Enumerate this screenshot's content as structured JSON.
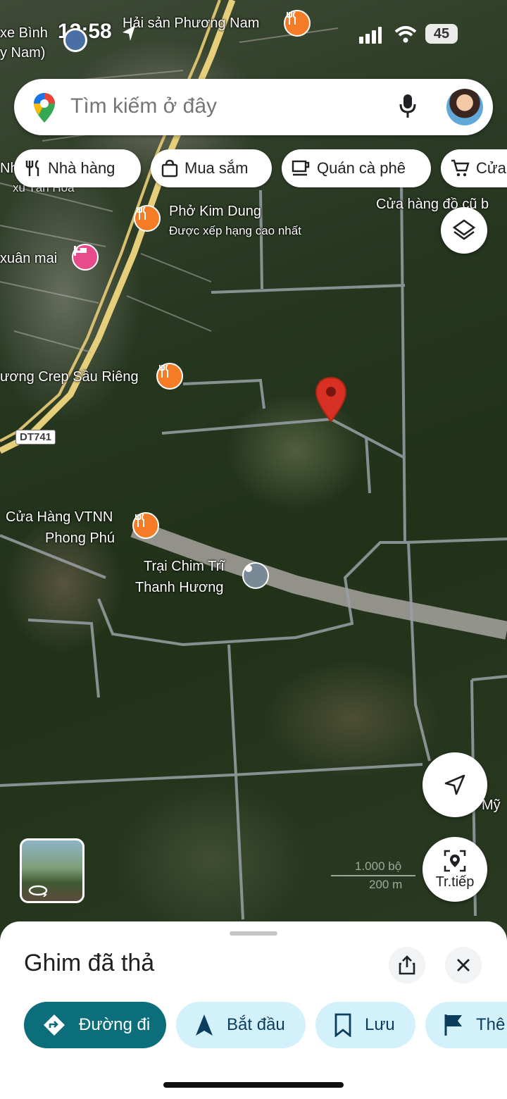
{
  "status_bar": {
    "time": "12:58",
    "battery": "45"
  },
  "search": {
    "placeholder": "Tìm kiếm ở đây"
  },
  "chips": [
    {
      "label": "Nhà hàng",
      "icon": "restaurant-icon"
    },
    {
      "label": "Mua sắm",
      "icon": "shopping-bag-icon"
    },
    {
      "label": "Quán cà phê",
      "icon": "coffee-icon"
    },
    {
      "label": "Cửa",
      "icon": "cart-icon"
    }
  ],
  "map_labels": {
    "xe_binh": "xe Bình",
    "y_nam": "y Nam)",
    "hai_san": "Hải sản Phương Nam",
    "nh": "Nh",
    "xu_tan_hoa": "xu Tân Hòa",
    "pho_kim_dung": "Phở Kim Dung",
    "pho_kim_dung_sub": "Được xếp hạng cao nhất",
    "cua_hang_do_cu": "Cửa hàng đồ cũ b",
    "xuan_mai": "xuân mai",
    "crep": "ương Crep Sầu Riêng",
    "road_badge": "DT741",
    "vtnn_1": "Cửa Hàng VTNN",
    "vtnn_2": "Phong Phú",
    "trai_chim_1": "Trại Chim Trĩ",
    "trai_chim_2": "Thanh Hương",
    "my": "Mỹ",
    "scale_ft": "1.000 bộ",
    "scale_m": "200 m"
  },
  "live_view_label": "Tr.tiếp",
  "sheet": {
    "title": "Ghim đã thả",
    "actions": [
      {
        "label": "Đường đi",
        "icon": "directions-icon"
      },
      {
        "label": "Bắt đầu",
        "icon": "navigation-arrow-icon"
      },
      {
        "label": "Lưu",
        "icon": "bookmark-icon"
      },
      {
        "label": "Thê",
        "icon": "flag-icon"
      }
    ]
  },
  "colors": {
    "accent": "#0b6e7a",
    "chip_bg": "#d3f1fb",
    "pin": "#d93025",
    "poi_food": "#f57c26"
  }
}
